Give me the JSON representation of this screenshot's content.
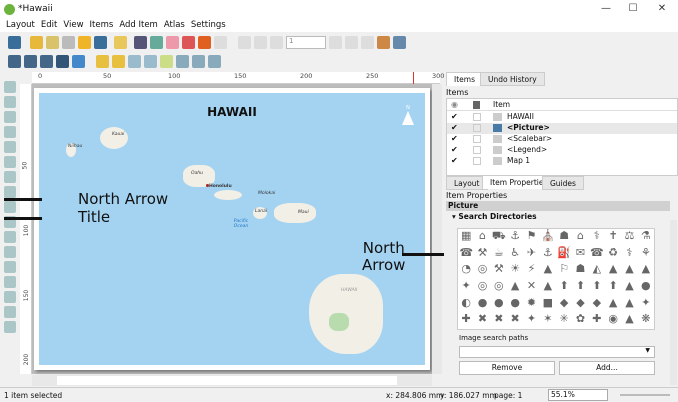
{
  "window": {
    "title": "*Hawaii",
    "minimize": "—",
    "maximize": "☐",
    "close": "✕"
  },
  "menu": [
    "Layout",
    "Edit",
    "View",
    "Items",
    "Add Item",
    "Atlas",
    "Settings"
  ],
  "toolbar": {
    "page_input": "1"
  },
  "ruler": {
    "h_ticks": [
      "0",
      "50",
      "100",
      "150",
      "200",
      "250",
      "300"
    ],
    "v_ticks": [
      "50",
      "100",
      "150",
      "200"
    ]
  },
  "map": {
    "title": "HAWAII",
    "labels": {
      "niihau": "Niihau",
      "kauai": "Kauai",
      "oahu": "Oahu",
      "honolulu": "Honolulu",
      "molokai": "Molokai",
      "lanai": "Lanai",
      "maui": "Maui",
      "ocean": "Pacific Ocean",
      "hawaii": "HAWAII"
    },
    "north_arrow": "N"
  },
  "annotations": {
    "north_arrow_left": "North Arrow",
    "title_left": "Title",
    "north_arrow_right_1": "North",
    "north_arrow_right_2": "Arrow"
  },
  "panel": {
    "tabs": [
      "Items",
      "Undo History"
    ],
    "items_title": "Items",
    "items_header": "Item",
    "items": [
      {
        "name": "HAWAII",
        "visible": true,
        "icon": "text-icon"
      },
      {
        "name": "<Picture>",
        "visible": true,
        "icon": "picture-icon",
        "selected": true
      },
      {
        "name": "<Scalebar>",
        "visible": true,
        "icon": "scalebar-icon"
      },
      {
        "name": "<Legend>",
        "visible": true,
        "icon": "legend-icon"
      },
      {
        "name": "Map 1",
        "visible": true,
        "icon": "map-icon"
      }
    ],
    "prop_tabs": [
      "Layout",
      "Item Properties",
      "Guides"
    ],
    "prop_title": "Item Properties",
    "section": "Picture",
    "subsection": "Search Directories",
    "search_paths_label": "Image search paths",
    "remove": "Remove",
    "add": "Add..."
  },
  "status": {
    "message": "1 item selected",
    "x": "x: 284.806 mm",
    "y": "y: 186.027 mm",
    "page": "page: 1",
    "zoom": "55.1%"
  }
}
